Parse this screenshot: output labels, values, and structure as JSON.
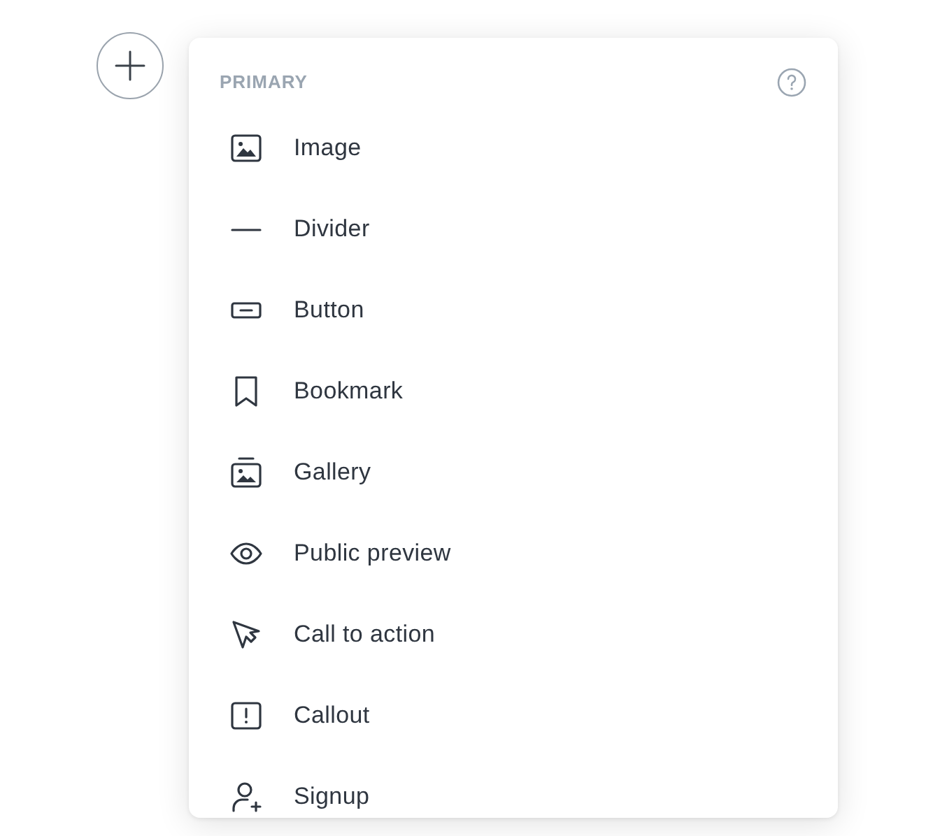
{
  "menu": {
    "section_title": "PRIMARY",
    "items": [
      {
        "label": "Image",
        "kind": "image"
      },
      {
        "label": "Divider",
        "kind": "divider"
      },
      {
        "label": "Button",
        "kind": "button"
      },
      {
        "label": "Bookmark",
        "kind": "bookmark"
      },
      {
        "label": "Gallery",
        "kind": "gallery"
      },
      {
        "label": "Public preview",
        "kind": "preview"
      },
      {
        "label": "Call to action",
        "kind": "cta"
      },
      {
        "label": "Callout",
        "kind": "callout"
      },
      {
        "label": "Signup",
        "kind": "signup"
      }
    ]
  }
}
